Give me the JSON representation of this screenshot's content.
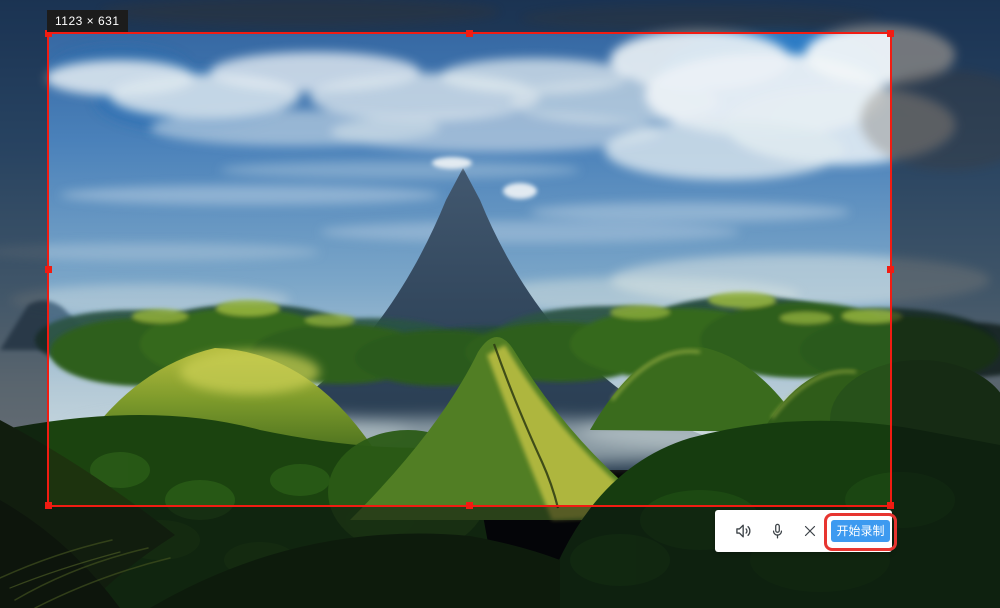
{
  "selection": {
    "size_label": "1123 × 631"
  },
  "toolbar": {
    "speaker_icon": "speaker-icon",
    "microphone_icon": "microphone-icon",
    "close_icon": "close-icon",
    "start_button_label": "开始录制"
  },
  "colors": {
    "selection_red": "#f11c12",
    "highlight_ring_red": "#e73530",
    "button_blue": "#3d9af0",
    "button_text": "#ffffff",
    "toolbar_bg": "#ffffff",
    "badge_bg": "#1c1c1c",
    "badge_text": "#ffffff",
    "icon_color": "#3c4247",
    "dim_overlay": "rgba(8,10,16,0.52)"
  }
}
